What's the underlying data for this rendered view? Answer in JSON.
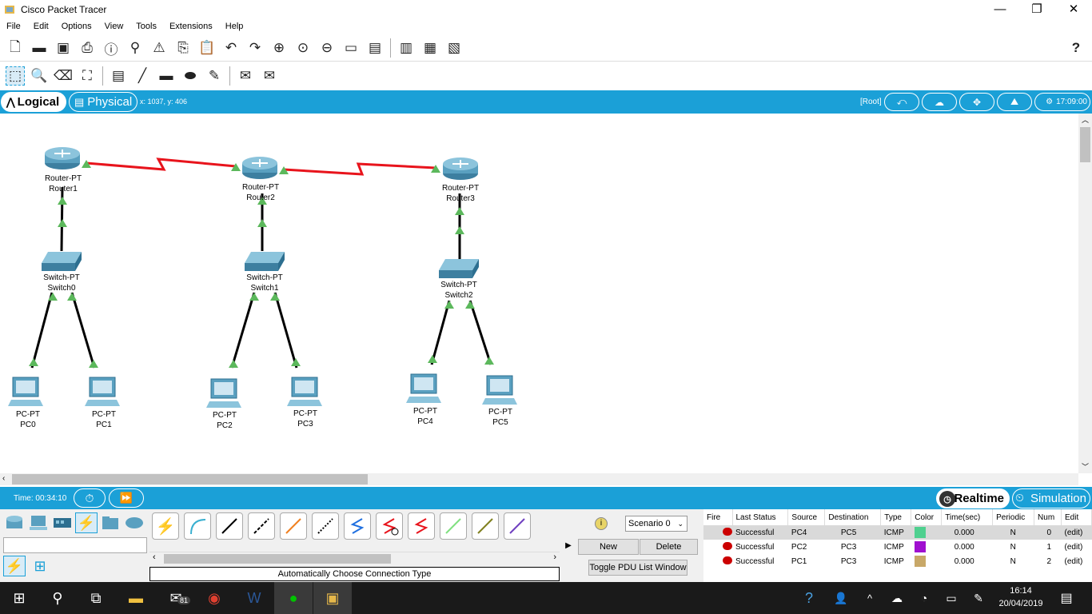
{
  "window": {
    "title": "Cisco Packet Tracer",
    "minimize": "—",
    "restore": "❐",
    "close": "✕"
  },
  "menu": [
    "File",
    "Edit",
    "Options",
    "View",
    "Tools",
    "Extensions",
    "Help"
  ],
  "toolbar_help": "?",
  "workspace": {
    "logical_label": "Logical",
    "physical_label": "Physical",
    "coords": "x: 1037, y: 406",
    "root_label": "[Root]",
    "clock": "17:09:00"
  },
  "devices": [
    {
      "model": "Router-PT",
      "name": "Router1"
    },
    {
      "model": "Router-PT",
      "name": "Router2"
    },
    {
      "model": "Router-PT",
      "name": "Router3"
    },
    {
      "model": "Switch-PT",
      "name": "Switch0"
    },
    {
      "model": "Switch-PT",
      "name": "Switch1"
    },
    {
      "model": "Switch-PT",
      "name": "Switch2"
    },
    {
      "model": "PC-PT",
      "name": "PC0"
    },
    {
      "model": "PC-PT",
      "name": "PC1"
    },
    {
      "model": "PC-PT",
      "name": "PC2"
    },
    {
      "model": "PC-PT",
      "name": "PC3"
    },
    {
      "model": "PC-PT",
      "name": "PC4"
    },
    {
      "model": "PC-PT",
      "name": "PC5"
    }
  ],
  "timebar": {
    "time": "Time: 00:34:10",
    "realtime": "Realtime",
    "simulation": "Simulation"
  },
  "bottom": {
    "auto_connection": "Automatically Choose Connection Type",
    "scenario": "Scenario 0",
    "new_btn": "New",
    "delete_btn": "Delete",
    "toggle_btn": "Toggle PDU List Window"
  },
  "pdu_table": {
    "headers": [
      "Fire",
      "Last Status",
      "Source",
      "Destination",
      "Type",
      "Color",
      "Time(sec)",
      "Periodic",
      "Num",
      "Edit"
    ],
    "rows": [
      {
        "status": "Successful",
        "source": "PC4",
        "destination": "PC5",
        "type": "ICMP",
        "color": "#4fd08f",
        "time": "0.000",
        "periodic": "N",
        "num": "0",
        "edit": "(edit)"
      },
      {
        "status": "Successful",
        "source": "PC2",
        "destination": "PC3",
        "type": "ICMP",
        "color": "#a010d0",
        "time": "0.000",
        "periodic": "N",
        "num": "1",
        "edit": "(edit)"
      },
      {
        "status": "Successful",
        "source": "PC1",
        "destination": "PC3",
        "type": "ICMP",
        "color": "#c8a868",
        "time": "0.000",
        "periodic": "N",
        "num": "2",
        "edit": "(edit)"
      }
    ]
  },
  "taskbar": {
    "mail_badge": "81",
    "time": "16:14",
    "date": "20/04/2019"
  },
  "colors": {
    "accent": "#1ba0d7",
    "serial_link": "#e8141c",
    "link_up": "#5cb85c"
  }
}
